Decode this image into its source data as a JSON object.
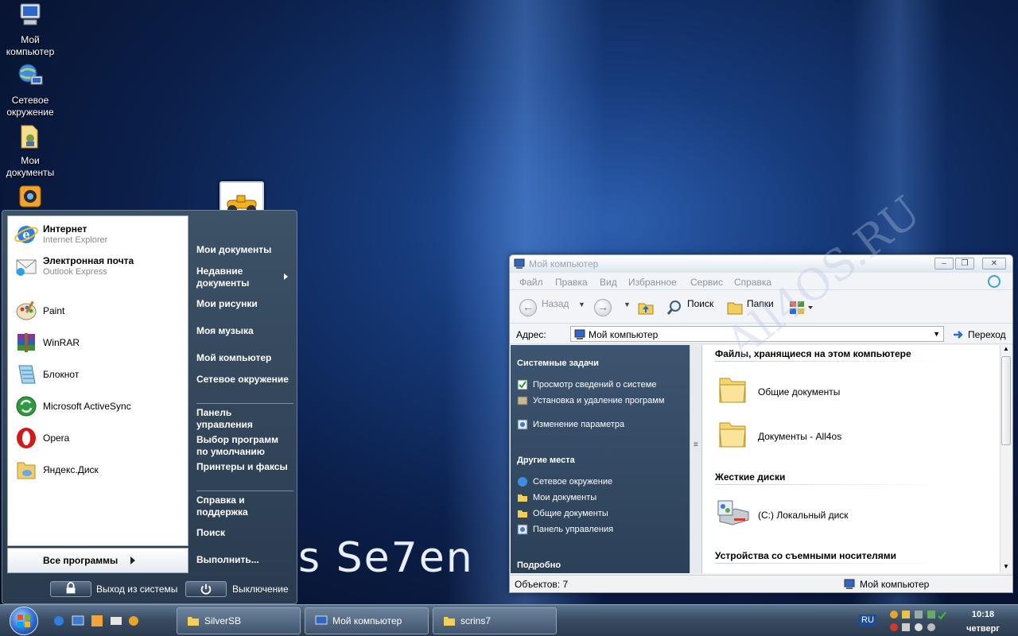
{
  "desktop": {
    "brand_text": "s Se7en",
    "icons": [
      {
        "label": "Мой компьютер",
        "icon": "computer-icon"
      },
      {
        "label": "Сетевое окружение",
        "icon": "network-icon"
      },
      {
        "label": "Мои документы",
        "icon": "documents-folder-icon"
      },
      {
        "label": "",
        "icon": "camera-app-icon"
      }
    ]
  },
  "start_menu": {
    "pinned": [
      {
        "name": "Интернет",
        "sub": "Internet Explorer",
        "icon": "internet-explorer-icon"
      },
      {
        "name": "Электронная почта",
        "sub": "Outlook Express",
        "icon": "outlook-express-icon"
      }
    ],
    "recent": [
      {
        "name": "Paint",
        "icon": "paint-icon"
      },
      {
        "name": "WinRAR",
        "icon": "winrar-icon"
      },
      {
        "name": "Блокнот",
        "icon": "notepad-icon"
      },
      {
        "name": "Microsoft ActiveSync",
        "icon": "activesync-icon"
      },
      {
        "name": "Opera",
        "icon": "opera-icon"
      },
      {
        "name": "Яндекс.Диск",
        "icon": "yandex-disk-icon"
      }
    ],
    "all_programs": "Все программы",
    "right": {
      "my_documents": "Мои документы",
      "recent_documents": "Недавние документы",
      "my_pictures": "Мои рисунки",
      "my_music": "Моя музыка",
      "my_computer": "Мой компьютер",
      "network": "Сетевое окружение",
      "control_panel": "Панель управления",
      "default_programs": "Выбор программ по умолчанию",
      "printers": "Принтеры и факсы",
      "help": "Справка и поддержка",
      "search": "Поиск",
      "run": "Выполнить..."
    },
    "logoff": "Выход из системы",
    "shutdown": "Выключение"
  },
  "explorer": {
    "title": "Мой компьютер",
    "menu": [
      "Файл",
      "Правка",
      "Вид",
      "Избранное",
      "Сервис",
      "Справка"
    ],
    "toolbar": {
      "back": "Назад",
      "search": "Поиск",
      "folders": "Папки"
    },
    "address_label": "Адрес:",
    "address_value": "Мой компьютер",
    "go_label": "Переход",
    "task_pane": {
      "system_tasks_title": "Системные задачи",
      "system_tasks": [
        "Просмотр сведений о системе",
        "Установка и удаление программ",
        "Изменение параметра"
      ],
      "other_places_title": "Другие места",
      "other_places": [
        "Сетевое окружение",
        "Мои документы",
        "Общие документы",
        "Панель управления"
      ],
      "details_title": "Подробно"
    },
    "groups": {
      "stored_files": "Файлы, хранящиеся на этом компьютере",
      "hard_disks": "Жесткие диски",
      "removable": "Устройства со съемными носителями"
    },
    "items": {
      "shared_docs": "Общие документы",
      "user_docs": "Документы - All4os",
      "local_disk": "(C:) Локальный диск"
    },
    "status_left": "Объектов: 7",
    "status_right": "Мой компьютер",
    "watermark": "All4OS.RU"
  },
  "taskbar": {
    "tasks": [
      {
        "label": "SilverSB",
        "icon": "folder-icon"
      },
      {
        "label": "Мой компьютер",
        "icon": "computer-icon"
      },
      {
        "label": "scrins7",
        "icon": "folder-icon"
      }
    ],
    "lang": "RU",
    "time": "10:18",
    "day": "четверг"
  }
}
